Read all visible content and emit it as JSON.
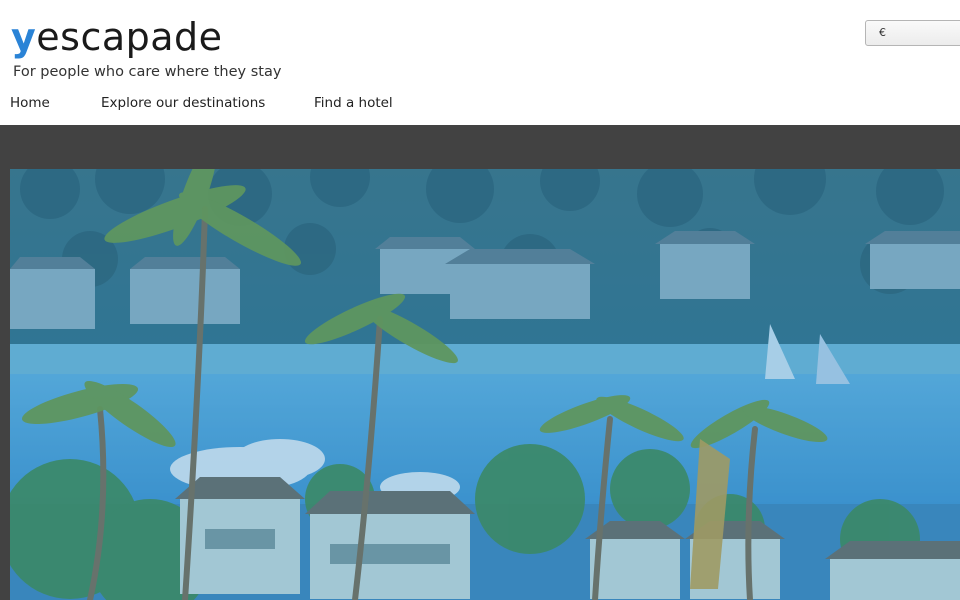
{
  "brand": {
    "logo_first_letter": "y",
    "logo_rest": "escapade",
    "tagline": "For people who care where they stay",
    "accent_color": "#2a83d6"
  },
  "currency": {
    "selected": "€"
  },
  "nav": {
    "items": [
      {
        "label": "Home"
      },
      {
        "label": "Explore our destinations"
      },
      {
        "label": "Find a hotel"
      }
    ]
  },
  "hero": {
    "image": "resort-beach-palms-photo",
    "overlay_color": "#2f86c8"
  },
  "colors": {
    "band": "#424242",
    "header_bg": "#ffffff"
  }
}
